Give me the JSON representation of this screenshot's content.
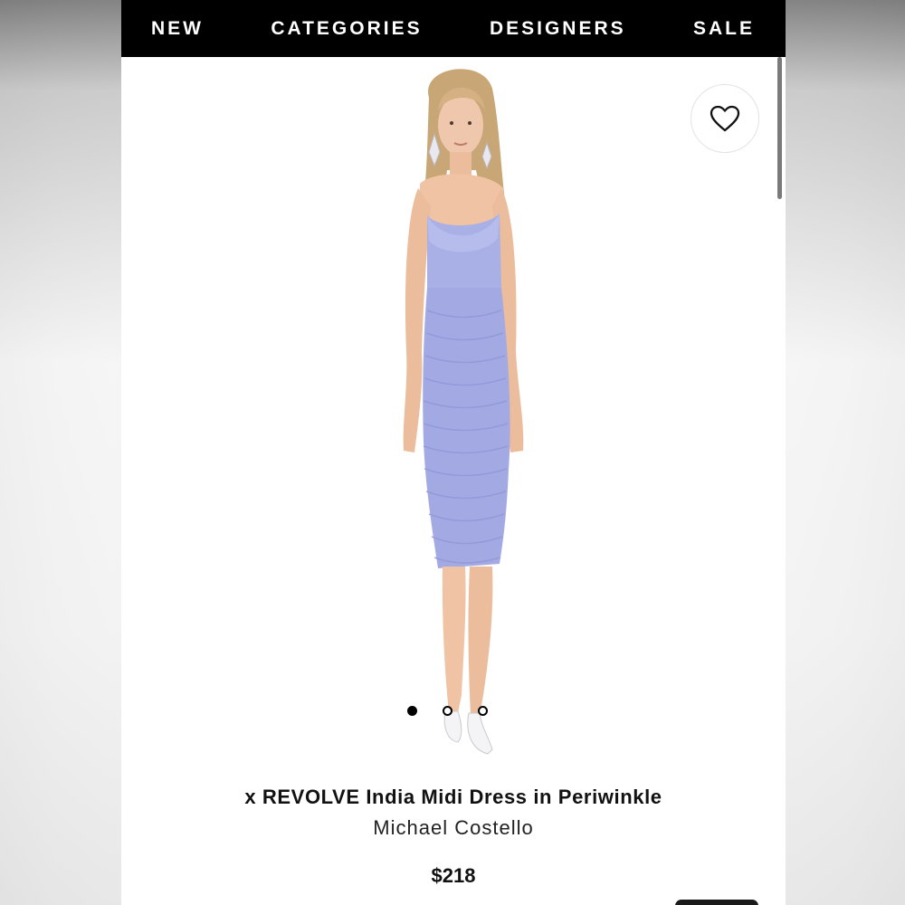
{
  "nav": {
    "items": [
      "NEW",
      "CATEGORIES",
      "DESIGNERS",
      "SALE"
    ]
  },
  "wishlist": {
    "icon": "heart-outline-icon"
  },
  "product": {
    "title": "x REVOLVE India Midi Dress in Periwinkle",
    "brand": "Michael Costello",
    "price": "$218",
    "dress_color": "#a9b0e6"
  },
  "carousel": {
    "total": 3,
    "active_index": 0
  },
  "colors": {
    "nav_bg": "#000000",
    "nav_text": "#ffffff",
    "page_bg": "#ffffff"
  }
}
